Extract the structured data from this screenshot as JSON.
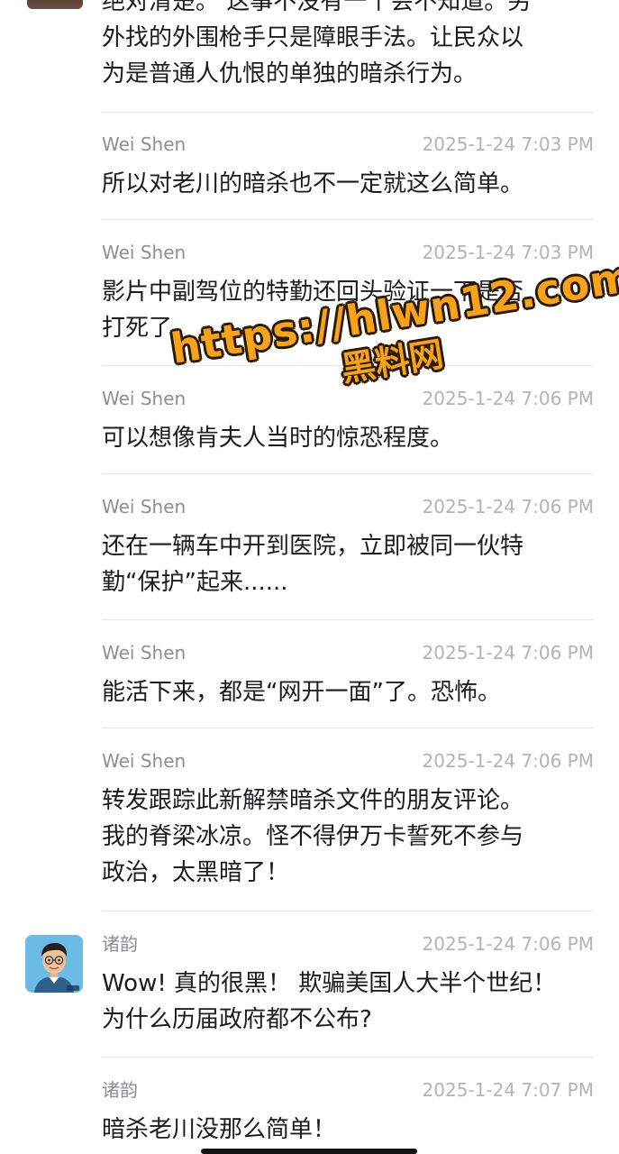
{
  "partial_comment": {
    "lines": [
      "绝对清楚。 这事不没有一个会不知道。另",
      "外找的外围枪手只是障眼手法。让民众以",
      "为是普通人仇恨的单独的暗杀行为。"
    ]
  },
  "comments": [
    {
      "author": "Wei Shen",
      "time": "2025-1-24 7:03 PM",
      "lines": [
        "所以对老川的暗杀也不一定就这么简单。"
      ]
    },
    {
      "author": "Wei Shen",
      "time": "2025-1-24 7:03 PM",
      "lines": [
        "影片中副驾位的特勤还回头验证一下是否",
        "打死了。"
      ]
    },
    {
      "author": "Wei Shen",
      "time": "2025-1-24 7:06 PM",
      "lines": [
        "可以想像肯夫人当时的惊恐程度。"
      ]
    },
    {
      "author": "Wei Shen",
      "time": "2025-1-24 7:06 PM",
      "lines": [
        "还在一辆车中开到医院，立即被同一伙特",
        "勤“保护”起来......"
      ]
    },
    {
      "author": "Wei Shen",
      "time": "2025-1-24 7:06 PM",
      "lines": [
        "能活下来，都是“网开一面”了。恐怖。"
      ]
    },
    {
      "author": "Wei Shen",
      "time": "2025-1-24 7:06 PM",
      "lines": [
        "转发跟踪此新解禁暗杀文件的朋友评论。",
        "我的脊梁冰凉。怪不得伊万卡誓死不参与",
        "政治，太黑暗了！"
      ]
    },
    {
      "author": "诸韵",
      "time": "2025-1-24 7:06 PM",
      "lines": [
        "Wow! 真的很黑！ 欺骗美国人大半个世纪！",
        "为什么历届政府都不公布?"
      ]
    },
    {
      "author": "诸韵",
      "time": "2025-1-24 7:07 PM",
      "lines": [
        "暗杀老川没那么简单！"
      ]
    }
  ],
  "watermark": {
    "url": "https://hlwn12.com",
    "name": "黑料网"
  }
}
